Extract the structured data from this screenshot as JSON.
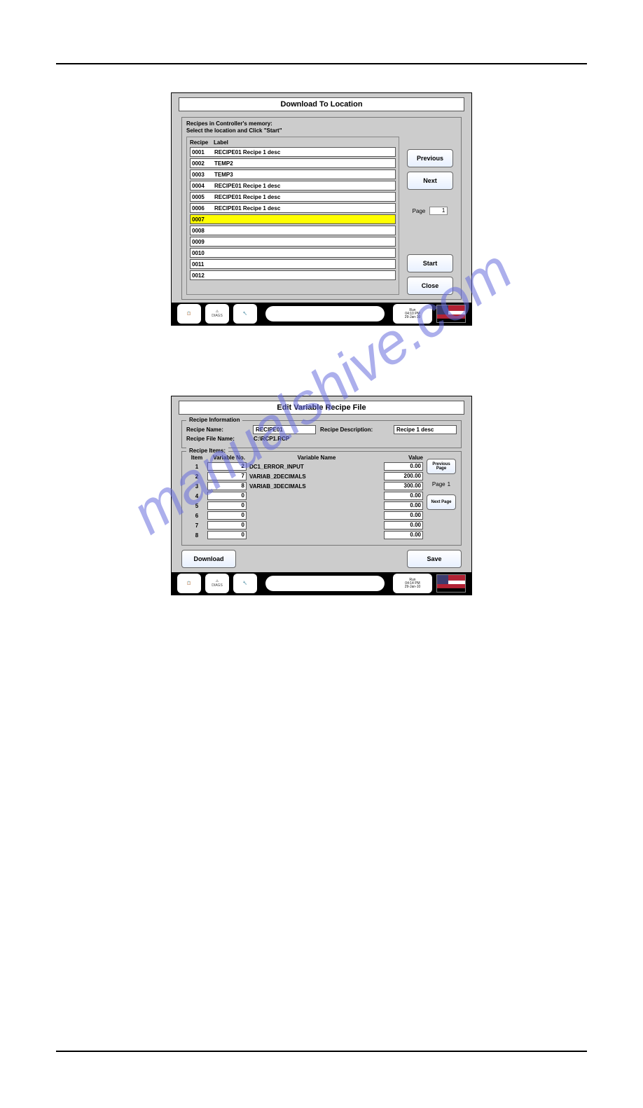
{
  "watermark": "manualshive.com",
  "dl_panel": {
    "title": "Download To Location",
    "instr1": "Recipes in Controller's memory:",
    "instr2": "Select the location and Click \"Start\"",
    "col1": "Recipe",
    "col2": "Label",
    "rows": [
      {
        "id": "0001",
        "label": "RECIPE01 Recipe 1 desc"
      },
      {
        "id": "0002",
        "label": "TEMP2"
      },
      {
        "id": "0003",
        "label": "TEMP3"
      },
      {
        "id": "0004",
        "label": "RECIPE01 Recipe 1 desc"
      },
      {
        "id": "0005",
        "label": "RECIPE01 Recipe 1 desc"
      },
      {
        "id": "0006",
        "label": "RECIPE01 Recipe 1 desc"
      },
      {
        "id": "0007",
        "label": ""
      },
      {
        "id": "0008",
        "label": ""
      },
      {
        "id": "0009",
        "label": ""
      },
      {
        "id": "0010",
        "label": ""
      },
      {
        "id": "0011",
        "label": ""
      },
      {
        "id": "0012",
        "label": ""
      }
    ],
    "selected": 6,
    "btn_prev": "Previous",
    "btn_next": "Next",
    "btn_start": "Start",
    "btn_close": "Close",
    "page_label": "Page",
    "page_val": "1"
  },
  "edit_panel": {
    "title": "Edit Variable Recipe File",
    "fs1": "Recipe Information",
    "fs2": "Recipe Items:",
    "name_lab": "Recipe Name:",
    "name_val": "RECIPE01",
    "desc_lab": "Recipe Description:",
    "desc_val": "Recipe 1 desc",
    "file_lab": "Recipe File Name:",
    "file_val": "C:\\RCP1.RCP",
    "h_item": "Item",
    "h_varno": "Variable No.",
    "h_varname": "Variable Name",
    "h_value": "Value",
    "rows": [
      {
        "item": "1",
        "varno": "2",
        "name": "DC1_ERROR_INPUT",
        "val": "0.00"
      },
      {
        "item": "2",
        "varno": "7",
        "name": "VARIAB_2DECIMALS",
        "val": "200.00"
      },
      {
        "item": "3",
        "varno": "8",
        "name": "VARIAB_3DECIMALS",
        "val": "300.00"
      },
      {
        "item": "4",
        "varno": "0",
        "name": "",
        "val": "0.00"
      },
      {
        "item": "5",
        "varno": "0",
        "name": "",
        "val": "0.00"
      },
      {
        "item": "6",
        "varno": "0",
        "name": "",
        "val": "0.00"
      },
      {
        "item": "7",
        "varno": "0",
        "name": "",
        "val": "0.00"
      },
      {
        "item": "8",
        "varno": "0",
        "name": "",
        "val": "0.00"
      }
    ],
    "btn_prev": "Previous Page",
    "btn_next": "Next Page",
    "page_label": "Page",
    "page_val": "1",
    "btn_dl": "Download",
    "btn_save": "Save"
  },
  "footer": {
    "diags": "DIAGS",
    "status1": "Run",
    "status2": "04:10 PM",
    "status3": "29-Jan-10",
    "status2b": "04:14 PM",
    "status3b": "29-Jan-10"
  }
}
